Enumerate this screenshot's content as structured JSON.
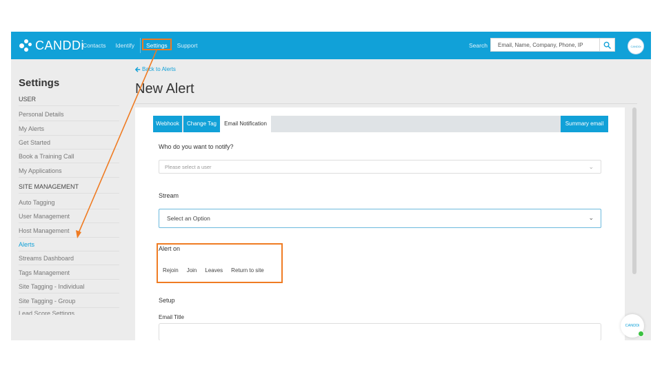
{
  "brand": {
    "name": "CANDDi"
  },
  "topnav": {
    "items": [
      {
        "label": "Contacts",
        "active": false
      },
      {
        "label": "Identify",
        "active": false
      },
      {
        "label": "Settings",
        "active": true
      },
      {
        "label": "Support",
        "active": false
      }
    ],
    "search_label": "Search",
    "search_placeholder": "Email, Name, Company, Phone, IP",
    "avatar_text": "CANDDi"
  },
  "sidebar": {
    "title": "Settings",
    "items": [
      {
        "label": "USER",
        "type": "header"
      },
      {
        "label": "Personal Details"
      },
      {
        "label": "My Alerts"
      },
      {
        "label": "Get Started"
      },
      {
        "label": "Book a Training Call"
      },
      {
        "label": "My Applications"
      },
      {
        "label": "SITE MANAGEMENT",
        "type": "header"
      },
      {
        "label": "Auto Tagging"
      },
      {
        "label": "User Management"
      },
      {
        "label": "Host Management"
      },
      {
        "label": "Alerts",
        "active": true
      },
      {
        "label": "Streams Dashboard"
      },
      {
        "label": "Tags Management"
      },
      {
        "label": "Site Tagging - Individual"
      },
      {
        "label": "Site Tagging - Group"
      },
      {
        "label": "Lead Score Settings"
      }
    ]
  },
  "main": {
    "back_link": "Back to Alerts",
    "page_title": "New Alert",
    "tabs": [
      {
        "label": "Webhook",
        "active": true
      },
      {
        "label": "Change Tag",
        "active": true
      },
      {
        "label": "Email Notification",
        "active": false
      },
      {
        "label": "Summary email",
        "active": true
      }
    ],
    "notify_label": "Who do you want to notify?",
    "notify_placeholder": "Please select a user",
    "stream_label": "Stream",
    "stream_value": "Select an Option",
    "alert_on_label": "Alert on",
    "alert_on_options": [
      "Rejoin",
      "Join",
      "Leaves",
      "Return to site"
    ],
    "setup_label": "Setup",
    "email_title_label": "Email Title"
  },
  "chat_widget": {
    "label": "CANDDi"
  },
  "colors": {
    "brand_blue": "#11a1d8",
    "annotation_orange": "#ef7b22",
    "online_green": "#3cc142"
  }
}
